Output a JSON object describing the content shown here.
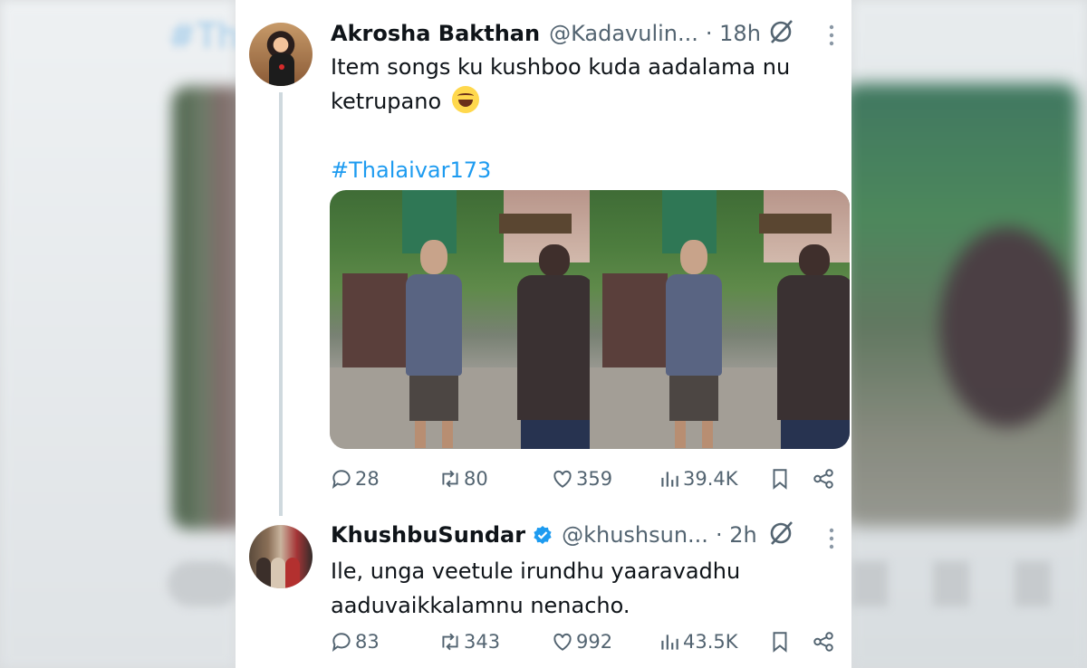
{
  "tweets": [
    {
      "name": "Akrosha Bakthan",
      "handle": "@Kadavulin...",
      "time": "· 18h",
      "text_lines": [
        "Item songs ku kushboo kuda aadalama nu",
        "ketrupano"
      ],
      "hashtag": "#Thalaivar173",
      "stats": {
        "replies": "28",
        "retweets": "80",
        "likes": "359",
        "views": "39.4K"
      }
    },
    {
      "name": "KhushbuSundar",
      "handle": "@khushsun...",
      "time": "· 2h",
      "verified": true,
      "text_lines": [
        "Ile, unga veetule irundhu yaaravadhu",
        "aaduvaikkalamnu nenacho."
      ],
      "stats": {
        "replies": "83",
        "retweets": "343",
        "likes": "992",
        "views": "43.5K"
      }
    }
  ],
  "colors": {
    "accent": "#1d9bf0",
    "text": "#0f1419",
    "muted": "#536471"
  }
}
